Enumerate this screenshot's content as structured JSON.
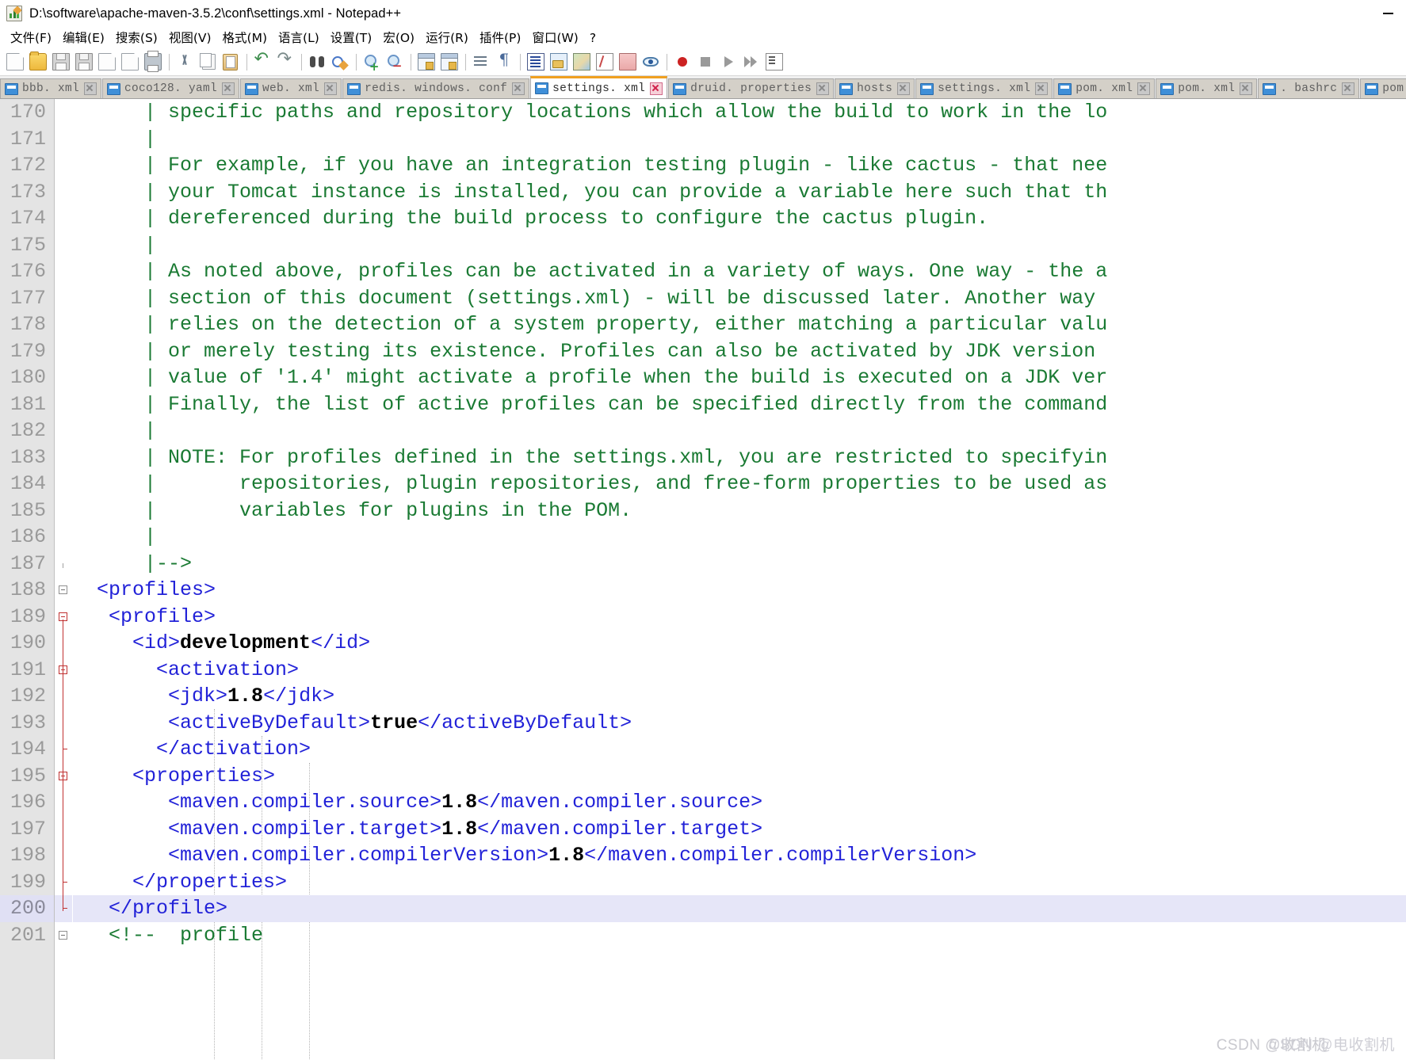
{
  "window": {
    "title": "D:\\software\\apache-maven-3.5.2\\conf\\settings.xml - Notepad++",
    "app_icon": "notepadpp-icon",
    "minimize_label": "—"
  },
  "menubar": {
    "items": [
      {
        "label": "文件(F)",
        "name": "menu-file"
      },
      {
        "label": "编辑(E)",
        "name": "menu-edit"
      },
      {
        "label": "搜索(S)",
        "name": "menu-search"
      },
      {
        "label": "视图(V)",
        "name": "menu-view"
      },
      {
        "label": "格式(M)",
        "name": "menu-encoding"
      },
      {
        "label": "语言(L)",
        "name": "menu-language"
      },
      {
        "label": "设置(T)",
        "name": "menu-settings"
      },
      {
        "label": "宏(O)",
        "name": "menu-macro"
      },
      {
        "label": "运行(R)",
        "name": "menu-run"
      },
      {
        "label": "插件(P)",
        "name": "menu-plugins"
      },
      {
        "label": "窗口(W)",
        "name": "menu-window"
      },
      {
        "label": "?",
        "name": "menu-help"
      }
    ]
  },
  "toolbar": {
    "buttons": [
      "new-file-icon",
      "open-file-icon",
      "save-icon",
      "save-all-icon",
      "close-file-icon",
      "close-all-icon",
      "print-icon",
      "cut-icon",
      "copy-icon",
      "paste-icon",
      "undo-icon",
      "redo-icon",
      "find-icon",
      "replace-icon",
      "zoom-in-icon",
      "zoom-out-icon",
      "sync-vertical-scroll-icon",
      "sync-horizontal-scroll-icon",
      "word-wrap-icon",
      "show-all-characters-icon",
      "indent-guideline-icon",
      "user-defined-language-icon",
      "document-map-icon",
      "function-list-icon",
      "folder-as-workspace-icon",
      "monitoring-icon",
      "record-macro-icon",
      "stop-recording-icon",
      "playback-macro-icon",
      "run-macro-multiple-icon",
      "save-macro-icon"
    ]
  },
  "tabs": [
    {
      "label": "bbb. xml",
      "active": false
    },
    {
      "label": "coco128. yaml",
      "active": false
    },
    {
      "label": "web. xml",
      "active": false
    },
    {
      "label": "redis. windows. conf",
      "active": false
    },
    {
      "label": "settings. xml",
      "active": true
    },
    {
      "label": "druid. properties",
      "active": false
    },
    {
      "label": "hosts",
      "active": false
    },
    {
      "label": "settings. xml",
      "active": false
    },
    {
      "label": "pom. xml",
      "active": false
    },
    {
      "label": "pom. xml",
      "active": false
    },
    {
      "label": ". bashrc",
      "active": false
    },
    {
      "label": "pom. xml",
      "active": false
    }
  ],
  "editor": {
    "first_line": 170,
    "current_line": 200,
    "lines": [
      {
        "n": 170,
        "segments": [
          {
            "t": "cmt",
            "s": "      | specific paths and repository locations which allow the build to work in the lo"
          }
        ]
      },
      {
        "n": 171,
        "segments": [
          {
            "t": "cmt",
            "s": "      |"
          }
        ]
      },
      {
        "n": 172,
        "segments": [
          {
            "t": "cmt",
            "s": "      | For example, if you have an integration testing plugin - like cactus - that nee"
          }
        ]
      },
      {
        "n": 173,
        "segments": [
          {
            "t": "cmt",
            "s": "      | your Tomcat instance is installed, you can provide a variable here such that th"
          }
        ]
      },
      {
        "n": 174,
        "segments": [
          {
            "t": "cmt",
            "s": "      | dereferenced during the build process to configure the cactus plugin."
          }
        ]
      },
      {
        "n": 175,
        "segments": [
          {
            "t": "cmt",
            "s": "      |"
          }
        ]
      },
      {
        "n": 176,
        "segments": [
          {
            "t": "cmt",
            "s": "      | As noted above, profiles can be activated in a variety of ways. One way - the a"
          }
        ]
      },
      {
        "n": 177,
        "segments": [
          {
            "t": "cmt",
            "s": "      | section of this document (settings.xml) - will be discussed later. Another way "
          }
        ]
      },
      {
        "n": 178,
        "segments": [
          {
            "t": "cmt",
            "s": "      | relies on the detection of a system property, either matching a particular valu"
          }
        ]
      },
      {
        "n": 179,
        "segments": [
          {
            "t": "cmt",
            "s": "      | or merely testing its existence. Profiles can also be activated by JDK version "
          }
        ]
      },
      {
        "n": 180,
        "segments": [
          {
            "t": "cmt",
            "s": "      | value of '1.4' might activate a profile when the build is executed on a JDK ver"
          }
        ]
      },
      {
        "n": 181,
        "segments": [
          {
            "t": "cmt",
            "s": "      | Finally, the list of active profiles can be specified directly from the command"
          }
        ]
      },
      {
        "n": 182,
        "segments": [
          {
            "t": "cmt",
            "s": "      |"
          }
        ]
      },
      {
        "n": 183,
        "segments": [
          {
            "t": "cmt",
            "s": "      | NOTE: For profiles defined in the settings.xml, you are restricted to specifyin"
          }
        ]
      },
      {
        "n": 184,
        "segments": [
          {
            "t": "cmt",
            "s": "      |       repositories, plugin repositories, and free-form properties to be used as"
          }
        ]
      },
      {
        "n": 185,
        "segments": [
          {
            "t": "cmt",
            "s": "      |       variables for plugins in the POM."
          }
        ]
      },
      {
        "n": 186,
        "segments": [
          {
            "t": "cmt",
            "s": "      |"
          }
        ]
      },
      {
        "n": 187,
        "segments": [
          {
            "t": "cmt",
            "s": "      |-->"
          }
        ]
      },
      {
        "n": 188,
        "segments": [
          {
            "t": "tag",
            "s": "  <profiles>"
          }
        ]
      },
      {
        "n": 189,
        "segments": [
          {
            "t": "tag",
            "s": "   <profile>"
          }
        ]
      },
      {
        "n": 190,
        "segments": [
          {
            "t": "tag",
            "s": "     <id>"
          },
          {
            "t": "txt",
            "s": "development"
          },
          {
            "t": "tag",
            "s": "</id>"
          }
        ]
      },
      {
        "n": 191,
        "segments": [
          {
            "t": "tag",
            "s": "       <activation>"
          }
        ]
      },
      {
        "n": 192,
        "segments": [
          {
            "t": "tag",
            "s": "        <jdk>"
          },
          {
            "t": "txt",
            "s": "1.8"
          },
          {
            "t": "tag",
            "s": "</jdk>"
          }
        ]
      },
      {
        "n": 193,
        "segments": [
          {
            "t": "tag",
            "s": "        <activeByDefault>"
          },
          {
            "t": "txt",
            "s": "true"
          },
          {
            "t": "tag",
            "s": "</activeByDefault>"
          }
        ]
      },
      {
        "n": 194,
        "segments": [
          {
            "t": "tag",
            "s": "       </activation>"
          }
        ]
      },
      {
        "n": 195,
        "segments": [
          {
            "t": "tag",
            "s": "     <properties>"
          }
        ]
      },
      {
        "n": 196,
        "segments": [
          {
            "t": "tag",
            "s": "        <maven.compiler.source>"
          },
          {
            "t": "txt",
            "s": "1.8"
          },
          {
            "t": "tag",
            "s": "</maven.compiler.source>"
          }
        ]
      },
      {
        "n": 197,
        "segments": [
          {
            "t": "tag",
            "s": "        <maven.compiler.target>"
          },
          {
            "t": "txt",
            "s": "1.8"
          },
          {
            "t": "tag",
            "s": "</maven.compiler.target>"
          }
        ]
      },
      {
        "n": 198,
        "segments": [
          {
            "t": "tag",
            "s": "        <maven.compiler.compilerVersion>"
          },
          {
            "t": "txt",
            "s": "1.8"
          },
          {
            "t": "tag",
            "s": "</maven.compiler.compilerVersion>"
          }
        ]
      },
      {
        "n": 199,
        "segments": [
          {
            "t": "tag",
            "s": "     </properties>"
          }
        ]
      },
      {
        "n": 200,
        "segments": [
          {
            "t": "tag",
            "s": "   </profile>"
          }
        ]
      },
      {
        "n": 201,
        "segments": [
          {
            "t": "cmt",
            "s": "   <!--  profile"
          }
        ]
      }
    ],
    "fold_markers": [
      {
        "line": 188,
        "type": "box",
        "color": "gray"
      },
      {
        "line": 189,
        "type": "box",
        "color": "red"
      },
      {
        "line": 191,
        "type": "box",
        "color": "red"
      },
      {
        "line": 194,
        "type": "tick",
        "color": "red"
      },
      {
        "line": 195,
        "type": "box",
        "color": "red"
      },
      {
        "line": 199,
        "type": "tick",
        "color": "red"
      },
      {
        "line": 200,
        "type": "tick",
        "color": "red"
      },
      {
        "line": 201,
        "type": "box",
        "color": "gray"
      }
    ]
  },
  "watermark": {
    "text_a": "CSDN @收割机",
    "text_b": "CSDN @电收割机"
  },
  "colors": {
    "comment_green": "#1a7a33",
    "tag_blue": "#2222d8",
    "value_black": "#000000",
    "gutter_gray": "#e4e4e4",
    "line_number": "#9a9a9a",
    "current_line_bg": "#e6e6f8",
    "active_tab_accent": "#f0a020",
    "fold_red": "#c03030"
  }
}
